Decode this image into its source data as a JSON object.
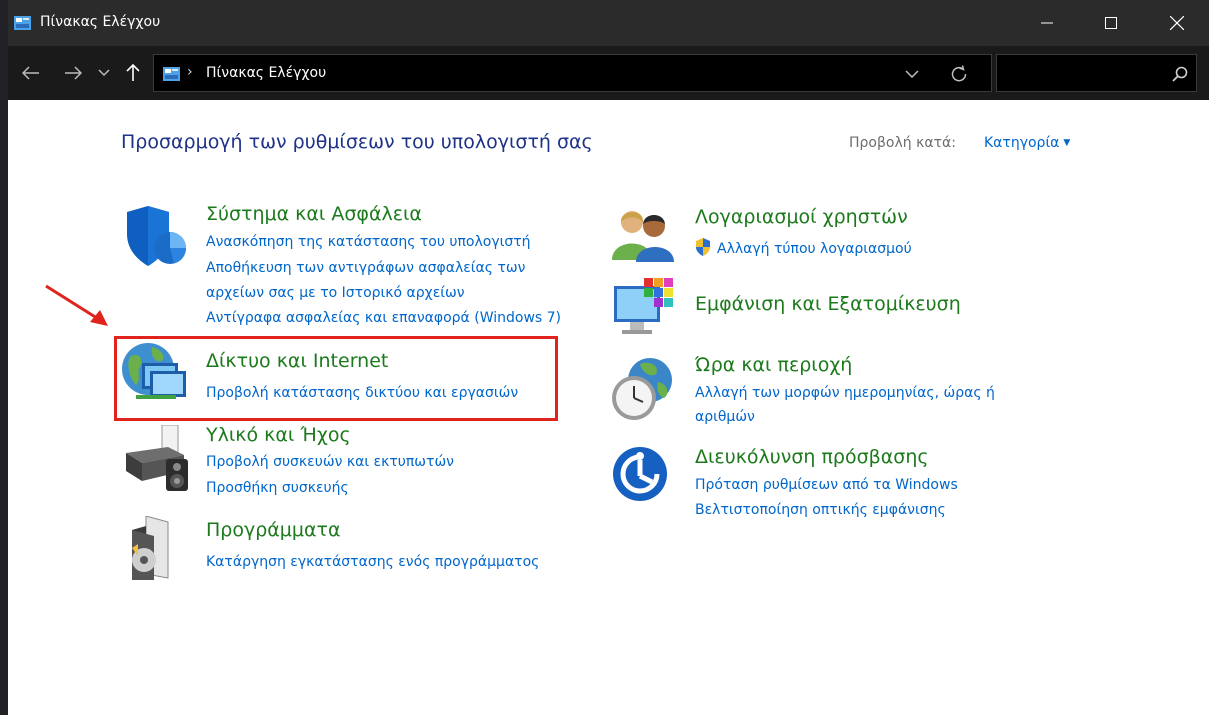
{
  "window": {
    "title": "Πίνακας Ελέγχου"
  },
  "address": {
    "path": "Πίνακας Ελέγχου",
    "separator": "›",
    "search_placeholder": ""
  },
  "header": {
    "heading": "Προσαρμογή των ρυθμίσεων του υπολογιστή σας",
    "view_by_label": "Προβολή κατά:",
    "view_by_value": "Κατηγορία"
  },
  "categories": {
    "system": {
      "title": "Σύστημα και Ασφάλεια",
      "links": [
        "Ανασκόπηση της κατάστασης του υπολογιστή",
        "Αποθήκευση των αντιγράφων ασφαλείας των",
        "αρχείων σας με το Ιστορικό αρχείων",
        "Αντίγραφα ασφαλείας και επαναφορά (Windows 7)"
      ]
    },
    "network": {
      "title": "Δίκτυο και Internet",
      "links": [
        "Προβολή κατάστασης δικτύου και εργασιών"
      ]
    },
    "hardware": {
      "title": "Υλικό και Ήχος",
      "links": [
        "Προβολή συσκευών και εκτυπωτών",
        "Προσθήκη συσκευής"
      ]
    },
    "programs": {
      "title": "Προγράμματα",
      "links": [
        "Κατάργηση εγκατάστασης ενός προγράμματος"
      ]
    },
    "accounts": {
      "title": "Λογαριασμοί χρηστών",
      "links": [
        "Αλλαγή τύπου λογαριασμού"
      ]
    },
    "appearance": {
      "title": "Εμφάνιση και Εξατομίκευση",
      "links": []
    },
    "clock": {
      "title": "Ώρα και περιοχή",
      "links": [
        "Αλλαγή των μορφών ημερομηνίας, ώρας ή",
        "αριθμών"
      ]
    },
    "access": {
      "title": "Διευκόλυνση πρόσβασης",
      "links": [
        "Πρόταση ρυθμίσεων από τα Windows",
        "Βελτιστοποίηση οπτικής εμφάνισης"
      ]
    }
  },
  "colors": {
    "category_title": "#1c7a1c",
    "link": "#0066cc",
    "heading": "#1e3287",
    "highlight": "#e0231d"
  },
  "icons": {
    "system": "shield-icon",
    "network": "network-globe-icon",
    "hardware": "printer-icon",
    "programs": "program-disc-icon",
    "accounts": "users-icon",
    "appearance": "monitor-palette-icon",
    "clock": "clock-globe-icon",
    "access": "ease-of-access-icon"
  }
}
